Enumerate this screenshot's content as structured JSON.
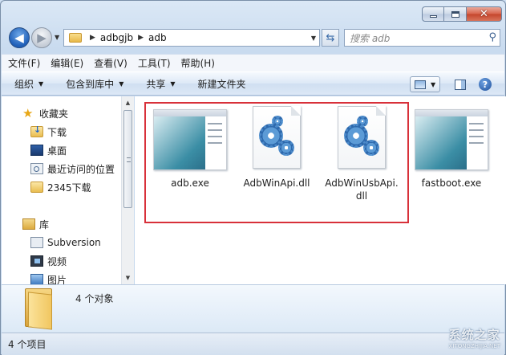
{
  "address": {
    "crumbs": [
      "adbgjb",
      "adb"
    ],
    "search_placeholder": "搜索 adb"
  },
  "menu": [
    "文件(F)",
    "编辑(E)",
    "查看(V)",
    "工具(T)",
    "帮助(H)"
  ],
  "toolbar": {
    "organize": "组织",
    "include_library": "包含到库中",
    "share": "共享",
    "new_folder": "新建文件夹"
  },
  "nav": {
    "favorites": "收藏夹",
    "downloads": "下载",
    "desktop": "桌面",
    "recent": "最近访问的位置",
    "download2345": "2345下载",
    "libraries": "库",
    "subversion": "Subversion",
    "videos": "视频",
    "pictures": "图片"
  },
  "files": [
    {
      "name": "adb.exe",
      "type": "exe"
    },
    {
      "name": "AdbWinApi.dll",
      "type": "dll"
    },
    {
      "name": "AdbWinUsbApi.\ndll",
      "type": "dll"
    },
    {
      "name": "fastboot.exe",
      "type": "exe"
    }
  ],
  "details": {
    "count": "4 个对象"
  },
  "status": {
    "items": "4 个项目"
  },
  "watermark": {
    "text": "系统之家",
    "sub": "XITONGZHIJIA.NET"
  },
  "colors": {
    "highlight": "#d8313a",
    "accent": "#1f5fb8"
  }
}
